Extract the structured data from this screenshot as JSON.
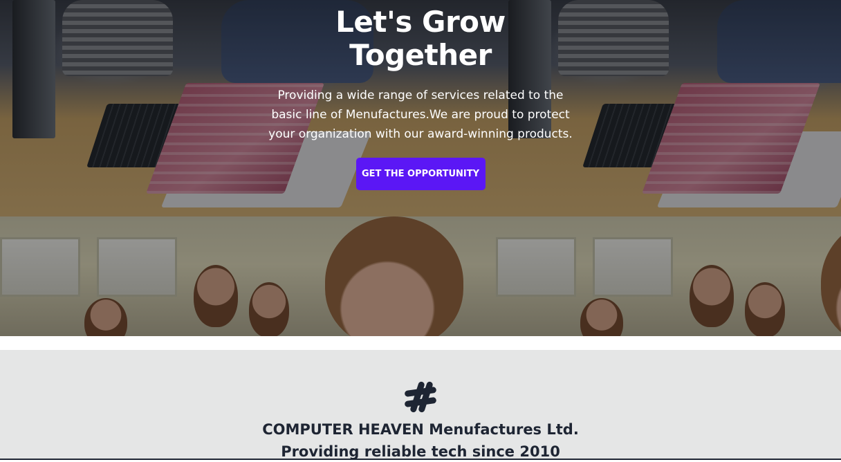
{
  "hero": {
    "title_line1": "Let's Grow",
    "title_line2": "Together",
    "description": "Providing a wide range of services related to the basic line of Menufactures.We are proud to protect your organization with our award-winning products.",
    "cta_label": "GET THE OPPORTUNITY"
  },
  "about": {
    "icon": "hashtag-icon",
    "line1": "COMPUTER HEAVEN Menufactures Ltd.",
    "line2": "Providing reliable tech since 2010"
  },
  "colors": {
    "accent": "#5b17f5",
    "text_dark": "#1e2533",
    "band_bg": "#e5e6e6"
  }
}
